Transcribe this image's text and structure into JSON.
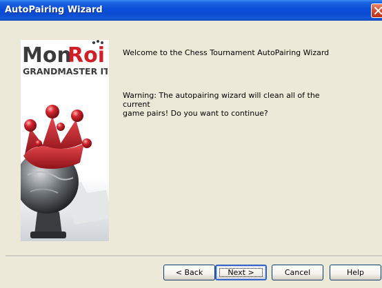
{
  "window": {
    "title": "AutoPairing Wizard"
  },
  "banner": {
    "brand_word_1": "Mon",
    "brand_word_2": "Roi",
    "tagline": "GRANDMASTER IT"
  },
  "content": {
    "welcome_text": "Welcome to the Chess Tournament AutoPairing Wizard",
    "warning_line_1": "Warning: The autopairing wizard will clean all of the current",
    "warning_line_2": "game pairs! Do you want to continue?"
  },
  "buttons": {
    "back": "< Back",
    "next": "Next >",
    "cancel": "Cancel",
    "help": "Help"
  },
  "colors": {
    "titlebar": "#0a4ed8",
    "dialog_bg": "#ece9d8",
    "crown_red": "#c4232a",
    "brand_red": "#d11f2a",
    "brand_dark": "#3b3b3b"
  }
}
